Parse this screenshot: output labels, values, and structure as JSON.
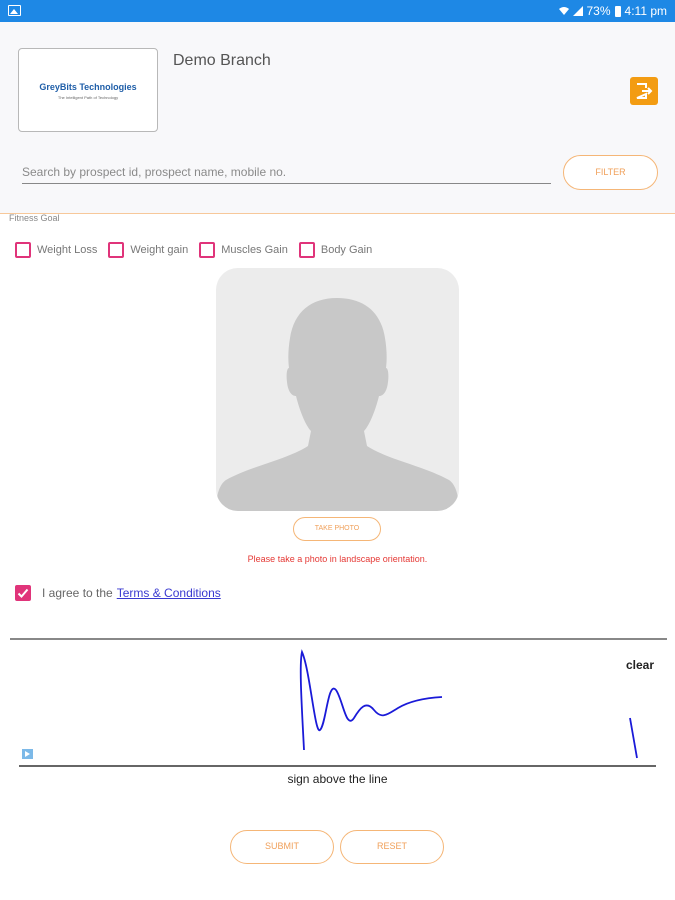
{
  "status_bar": {
    "battery": "73%",
    "time": "4:11 pm",
    "icons": [
      "gallery-icon",
      "wifi-icon",
      "signal-icon",
      "battery-icon"
    ]
  },
  "header": {
    "logo_title": "GreyBits Technologies",
    "logo_subtitle": "The Intelligent Path of Technology",
    "branch_name": "Demo Branch",
    "logout_icon": "logout-icon"
  },
  "search": {
    "placeholder": "Search by prospect id, prospect name, mobile no.",
    "value": "",
    "filter_label": "FILTER"
  },
  "form": {
    "section_label": "Fitness Goal",
    "goals": [
      {
        "label": "Weight Loss",
        "checked": false
      },
      {
        "label": "Weight gain",
        "checked": false
      },
      {
        "label": "Muscles Gain",
        "checked": false
      },
      {
        "label": "Body Gain",
        "checked": false
      }
    ],
    "take_photo_label": "TAKE PHOTO",
    "photo_hint": "Please take a photo in landscape orientation.",
    "terms_prefix": "I agree to the",
    "terms_link": "Terms & Conditions",
    "terms_checked": true
  },
  "signature": {
    "clear_label": "clear",
    "caption": "sign above the line"
  },
  "actions": {
    "submit_label": "SUBMIT",
    "reset_label": "RESET"
  },
  "colors": {
    "status_bar": "#1e88e5",
    "accent_orange": "#f0a05a",
    "checkbox_pink": "#e0347a",
    "hint_red": "#e53935",
    "ink_blue": "#1a1ad8"
  }
}
